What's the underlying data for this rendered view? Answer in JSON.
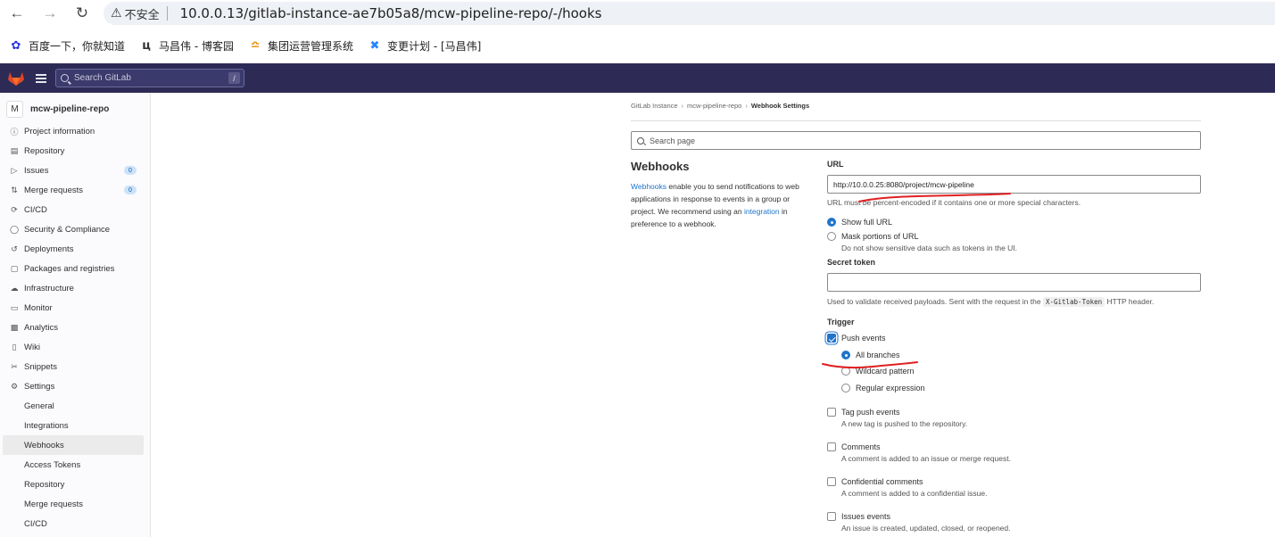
{
  "browser": {
    "security_label": "不安全",
    "url": "10.0.0.13/gitlab-instance-ae7b05a8/mcw-pipeline-repo/-/hooks",
    "bookmarks": [
      {
        "label": "百度一下，你就知道",
        "icon": "baidu-paw-icon"
      },
      {
        "label": "马昌伟 - 博客园",
        "icon": "cnblogs-icon"
      },
      {
        "label": "集团运营管理系统",
        "icon": "ops-system-icon"
      },
      {
        "label": "变更计划 - [马昌伟]",
        "icon": "confluence-icon"
      }
    ]
  },
  "header": {
    "search_placeholder": "Search GitLab",
    "search_shortcut": "/",
    "colors": {
      "bg": "#2d2b55",
      "logo": "#e24329"
    }
  },
  "sidebar": {
    "project_initial": "M",
    "project_name": "mcw-pipeline-repo",
    "items": [
      {
        "label": "Project information",
        "icon": "info-icon"
      },
      {
        "label": "Repository",
        "icon": "doc-icon"
      },
      {
        "label": "Issues",
        "icon": "issues-icon",
        "count": "0"
      },
      {
        "label": "Merge requests",
        "icon": "merge-icon",
        "count": "0"
      },
      {
        "label": "CI/CD",
        "icon": "rocket-icon"
      },
      {
        "label": "Security & Compliance",
        "icon": "shield-icon"
      },
      {
        "label": "Deployments",
        "icon": "deploy-icon"
      },
      {
        "label": "Packages and registries",
        "icon": "package-icon"
      },
      {
        "label": "Infrastructure",
        "icon": "cloud-icon"
      },
      {
        "label": "Monitor",
        "icon": "monitor-icon"
      },
      {
        "label": "Analytics",
        "icon": "chart-icon"
      },
      {
        "label": "Wiki",
        "icon": "book-icon"
      },
      {
        "label": "Snippets",
        "icon": "scissors-icon"
      },
      {
        "label": "Settings",
        "icon": "settings-icon"
      }
    ],
    "settings_sub": [
      "General",
      "Integrations",
      "Webhooks",
      "Access Tokens",
      "Repository",
      "Merge requests",
      "CI/CD"
    ]
  },
  "breadcrumb": [
    "GitLab Instance",
    "mcw-pipeline-repo",
    "Webhook Settings"
  ],
  "page_search_placeholder": "Search page",
  "webhooks": {
    "title": "Webhooks",
    "desc_link1": "Webhooks",
    "desc_part1": " enable you to send notifications to web applications in response to events in a group or project. We recommend using an ",
    "desc_link2": "integration",
    "desc_part2": " in preference to a webhook."
  },
  "form": {
    "url_label": "URL",
    "url_value": "http://10.0.0.25:8080/project/mcw-pipeline",
    "url_help": "URL must be percent-encoded if it contains one or more special characters.",
    "show_full_url": "Show full URL",
    "mask_url": "Mask portions of URL",
    "mask_url_desc": "Do not show sensitive data such as tokens in the UI.",
    "secret_label": "Secret token",
    "secret_value": "",
    "secret_help_1": "Used to validate received payloads. Sent with the request in the",
    "secret_help_code": "X-Gitlab-Token",
    "secret_help_2": "HTTP header.",
    "trigger_label": "Trigger",
    "push_events": "Push events",
    "all_branches": "All branches",
    "wildcard": "Wildcard pattern",
    "regex": "Regular expression",
    "events": [
      {
        "title": "Tag push events",
        "desc": "A new tag is pushed to the repository."
      },
      {
        "title": "Comments",
        "desc": "A comment is added to an issue or merge request."
      },
      {
        "title": "Confidential comments",
        "desc": "A comment is added to a confidential issue."
      },
      {
        "title": "Issues events",
        "desc": "An issue is created, updated, closed, or reopened."
      }
    ]
  },
  "annotation_color": "#e02020"
}
